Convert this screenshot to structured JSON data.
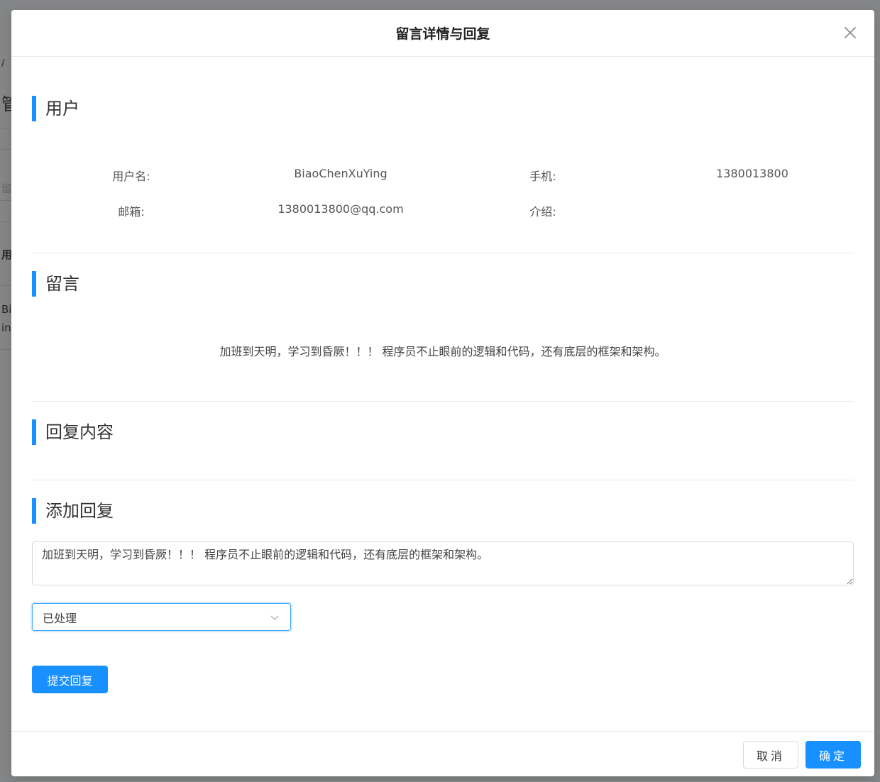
{
  "background": {
    "fragments": [
      "/",
      "管",
      "留",
      "用",
      "Bi",
      "in"
    ]
  },
  "modal": {
    "title": "留言详情与回复",
    "close_icon": "close-icon"
  },
  "sections": {
    "user": "用户",
    "message": "留言",
    "reply_content": "回复内容",
    "add_reply": "添加回复"
  },
  "user_info": {
    "username_label": "用户名:",
    "username_value": "BiaoChenXuYing",
    "phone_label": "手机:",
    "phone_value": "1380013800",
    "email_label": "邮箱:",
    "email_value": "1380013800@qq.com",
    "intro_label": "介绍:",
    "intro_value": ""
  },
  "message": {
    "text": "加班到天明，学习到昏厥！！！ 程序员不止眼前的逻辑和代码，还有底层的框架和架构。"
  },
  "reply_form": {
    "textarea_value": "加班到天明，学习到昏厥！！！ 程序员不止眼前的逻辑和代码，还有底层的框架和架构。",
    "status_selected": "已处理",
    "submit_label": "提交回复"
  },
  "footer": {
    "cancel_label": "取消",
    "ok_label": "确定"
  },
  "colors": {
    "primary": "#1890ff",
    "mask": "rgba(0,0,0,0.45)"
  }
}
